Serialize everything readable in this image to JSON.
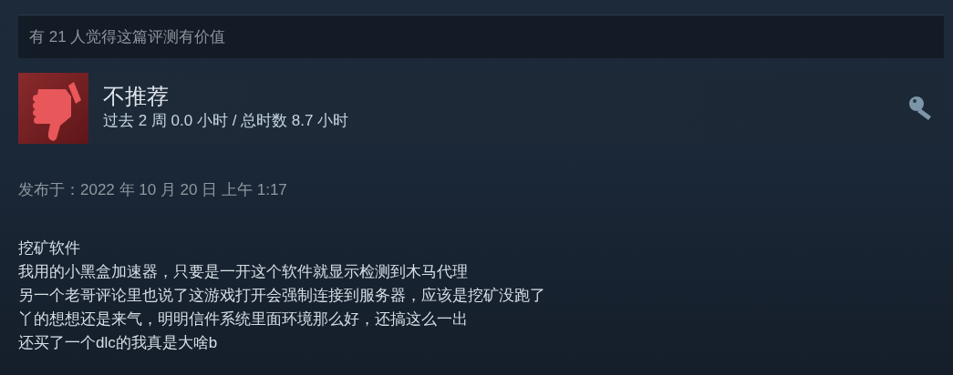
{
  "helpful_count_text": "有 21 人觉得这篇评测有价值",
  "review": {
    "recommended": false,
    "verdict": "不推荐",
    "playtime": "过去 2 周 0.0 小时 / 总时数 8.7 小时",
    "activated_with_key": true
  },
  "posted": "发布于：2022 年 10 月 20 日 上午 1:17",
  "body_lines": [
    "挖矿软件",
    "我用的小黑盒加速器，只要是一开这个软件就显示检测到木马代理",
    "另一个老哥评论里也说了这游戏打开会强制连接到服务器，应该是挖矿没跑了",
    "丫的想想还是来气，明明信件系统里面环境那么好，还搞这么一出",
    "还买了一个dlc的我真是大啥b"
  ]
}
